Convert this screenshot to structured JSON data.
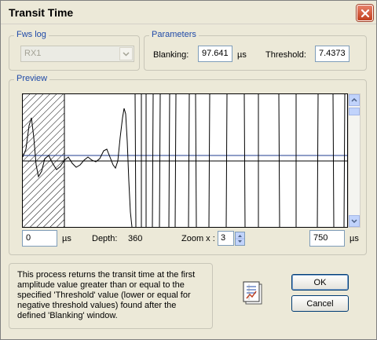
{
  "window": {
    "title": "Transit Time"
  },
  "fws_log": {
    "group_label": "Fws log",
    "selected": "RX1"
  },
  "parameters": {
    "group_label": "Parameters",
    "blanking_label": "Blanking:",
    "blanking_value": "97.641",
    "blanking_unit": "µs",
    "threshold_label": "Threshold:",
    "threshold_value": "7.4373"
  },
  "preview": {
    "group_label": "Preview",
    "start_value": "0",
    "start_unit": "µs",
    "depth_label": "Depth:",
    "depth_value": "360",
    "zoom_label": "Zoom x :",
    "zoom_value": "3",
    "end_value": "750",
    "end_unit": "µs"
  },
  "info_text": "This process returns the transit time at the first amplitude value greater than or equal to the specified 'Threshold' value (lower or equal for negative threshold values) found after the defined 'Blanking' window.",
  "buttons": {
    "ok": "OK",
    "cancel": "Cancel"
  },
  "icons": {
    "close": "close-icon",
    "report": "report-icon",
    "dropdown": "chevron-down-icon"
  },
  "colors": {
    "accent": "#1f4aa8",
    "close_button": "#c1401f",
    "trace": "#000000",
    "threshold_line": "#1f3b8f"
  }
}
